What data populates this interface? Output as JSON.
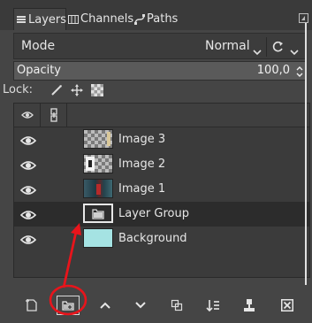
{
  "tabs": [
    {
      "label": "Layers",
      "icon": "layers-icon",
      "active": true
    },
    {
      "label": "Channels",
      "icon": "channels-icon",
      "active": false
    },
    {
      "label": "Paths",
      "icon": "paths-icon",
      "active": false
    }
  ],
  "mode": {
    "label": "Mode",
    "value": "Normal"
  },
  "opacity": {
    "label": "Opacity",
    "value": "100,0",
    "fraction": 1.0
  },
  "lock": {
    "label": "Lock:",
    "icons": [
      "lock-pixels-icon",
      "lock-position-icon",
      "lock-alpha-icon"
    ]
  },
  "layers": [
    {
      "name": "Image 3",
      "visible": true,
      "thumb": "checker",
      "selected": false
    },
    {
      "name": "Image 2",
      "visible": true,
      "thumb": "checker",
      "selected": false
    },
    {
      "name": "Image 1",
      "visible": true,
      "thumb": "checker",
      "selected": false
    },
    {
      "name": "Layer Group",
      "visible": true,
      "thumb": "folder",
      "selected": true
    },
    {
      "name": "Background",
      "visible": true,
      "thumb": "solid",
      "selected": false
    }
  ],
  "colors": {
    "panel_bg": "#454545",
    "list_bg": "#3b3b3b",
    "selected_row": "#2c2c2c",
    "background_thumb": "#a5e3e3",
    "annotation": "#e8141b"
  },
  "toolbar": {
    "buttons": [
      "new-layer-icon",
      "new-layer-group-icon",
      "raise-layer-icon",
      "lower-layer-icon",
      "duplicate-layer-icon",
      "merge-layer-icon",
      "anchor-layer-icon",
      "delete-layer-icon"
    ]
  }
}
